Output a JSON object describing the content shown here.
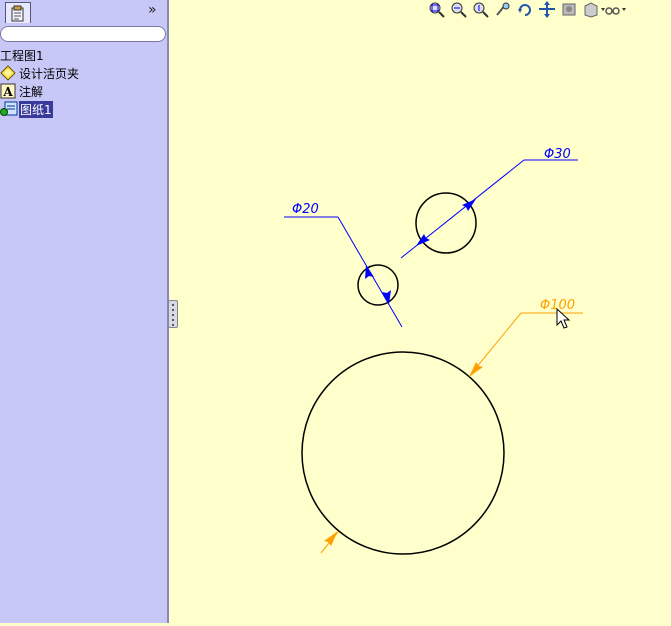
{
  "sidebar": {
    "tree": [
      {
        "label": "工程图1",
        "icon": "drawing-icon"
      },
      {
        "label": "设计活页夹",
        "icon": "binder-icon"
      },
      {
        "label": "注解",
        "icon": "annotation-icon"
      },
      {
        "label": "图纸1",
        "icon": "sheet-icon",
        "selected": true
      }
    ],
    "expand_glyph": "»"
  },
  "drawing": {
    "dimensions": [
      {
        "label": "Φ30",
        "color": "#0000ff"
      },
      {
        "label": "Φ20",
        "color": "#0000ff"
      },
      {
        "label": "Φ100",
        "color": "#ffa000"
      }
    ]
  },
  "toolbar": {
    "icons": [
      "zoom-to-fit-icon",
      "zoom-area-icon",
      "zoom-in-out-icon",
      "zoom-selection-icon",
      "rotate-icon",
      "pan-icon",
      "display-style-icon",
      "view-orientation-icon",
      "hide-show-icon"
    ]
  },
  "colors": {
    "canvas_bg": "#ffffcc",
    "sidebar_bg": "#c8c8f8",
    "dim_blue": "#0000ff",
    "dim_orange": "#ffa000"
  }
}
